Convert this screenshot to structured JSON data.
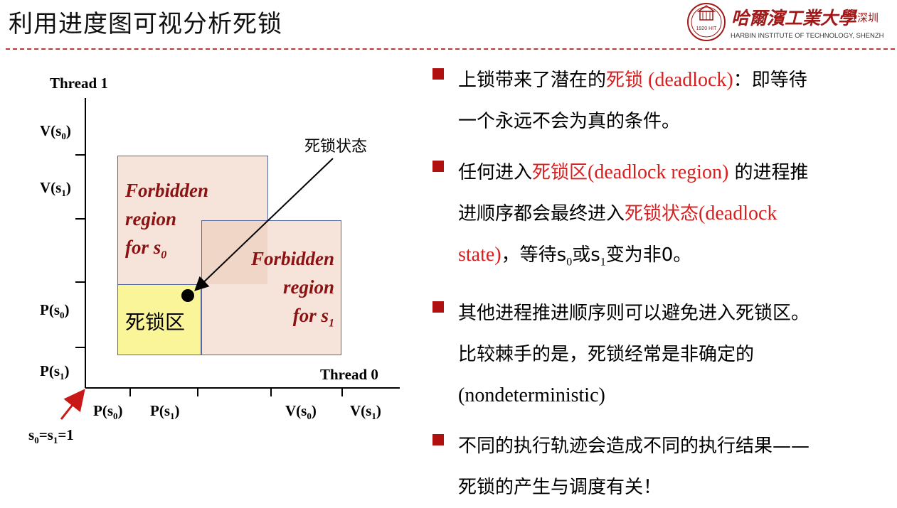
{
  "header": {
    "title": "利用进度图可视分析死锁",
    "logo_name": "哈爾濱工業大學",
    "logo_suffix": "（深圳",
    "logo_en": "HARBIN INSTITUTE OF TECHNOLOGY, SHENZH",
    "seal_text": "1920 HIT"
  },
  "diagram": {
    "y_axis_label": "Thread 1",
    "x_axis_label": "Thread 0",
    "y_ticks": [
      {
        "op": "V",
        "sub": "0"
      },
      {
        "op": "V",
        "sub": "1"
      },
      {
        "op": "P",
        "sub": "0"
      },
      {
        "op": "P",
        "sub": "1"
      }
    ],
    "x_ticks": [
      {
        "op": "P",
        "sub": "0"
      },
      {
        "op": "P",
        "sub": "1"
      },
      {
        "op": "V",
        "sub": "0"
      },
      {
        "op": "V",
        "sub": "1"
      }
    ],
    "tick_text": {
      "open": "(s",
      "close": ")"
    },
    "origin_label": {
      "s0": "s",
      "sub0": "0",
      "eq": "=s",
      "sub1": "1",
      "val": "=1"
    },
    "forbidden_s0": {
      "line1": "Forbidden",
      "line2": "region",
      "line3": "for s",
      "sub": "0"
    },
    "forbidden_s1": {
      "line1": "Forbidden",
      "line2": "region",
      "line3": "for s",
      "sub": "1"
    },
    "deadlock_region_label": "死锁区",
    "deadlock_state_label": "死锁状态",
    "colors": {
      "forbidden_fill": "#f6e4da",
      "overlap_fill": "#f0d6c6",
      "deadlock_fill": "#fbf59a",
      "forbidden_text": "#8a1212",
      "arrow_red": "#c81818"
    }
  },
  "bullets": [
    {
      "lines": [
        {
          "a": "上锁带来了潜在的",
          "b_red": "死锁",
          "c_red": " (deadlock)",
          "d": "：即等待"
        },
        {
          "a": "一个永远不会为真的条件。"
        }
      ]
    },
    {
      "lines": [
        {
          "a": "任何进入",
          "b_red": "死锁区",
          "c_red": "(deadlock region)",
          "d": " 的进程推"
        },
        {
          "a": "进顺序都会最终进入",
          "b_red": "死锁状态",
          "c_red": "(deadlock"
        },
        {
          "a_red": "state)",
          "b": "，等待s",
          "sub0": "0",
          "c": "或s",
          "sub1": "1",
          "d": "变为非0。"
        }
      ]
    },
    {
      "lines": [
        {
          "a": "其他进程推进顺序则可以避免进入死锁区。"
        },
        {
          "a": "比较棘手的是，死锁经常是非确定的"
        },
        {
          "a": "(nondeterministic)"
        }
      ]
    },
    {
      "lines": [
        {
          "a": "不同的执行轨迹会造成不同的执行结果——"
        },
        {
          "a": "死锁的产生与调度有关！"
        }
      ]
    }
  ]
}
